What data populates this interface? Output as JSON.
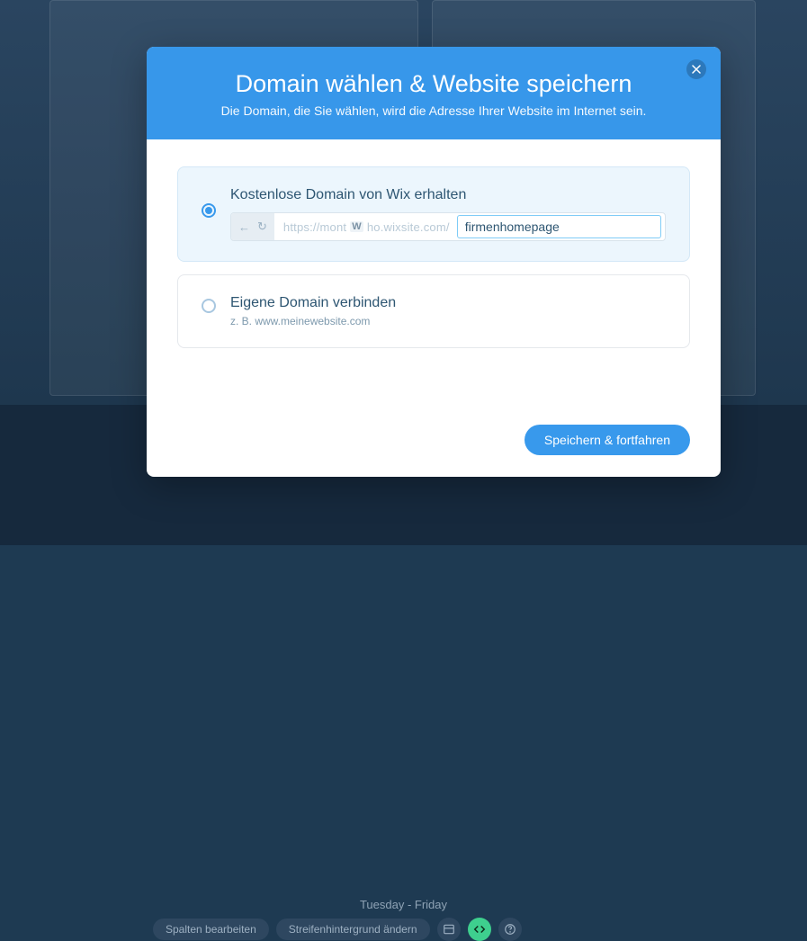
{
  "background": {
    "schedule_text": "Tuesday - Friday",
    "toolbar": {
      "btn1": "Spalten bearbeiten",
      "btn2": "Streifenhintergrund ändern"
    }
  },
  "modal": {
    "title": "Domain wählen & Website speichern",
    "subtitle": "Die Domain, die Sie wählen, wird die Adresse Ihrer Website im Internet sein.",
    "close_aria": "Schließen",
    "option_free": {
      "title": "Kostenlose Domain von Wix erhalten",
      "url_prefix_left": "https://mont",
      "url_prefix_right": "ho.wixsite.com/",
      "input_value": "firmenhomepage"
    },
    "option_own": {
      "title": "Eigene Domain verbinden",
      "hint": "z. B. www.meinewebsite.com"
    },
    "submit_label": "Speichern & fortfahren"
  }
}
